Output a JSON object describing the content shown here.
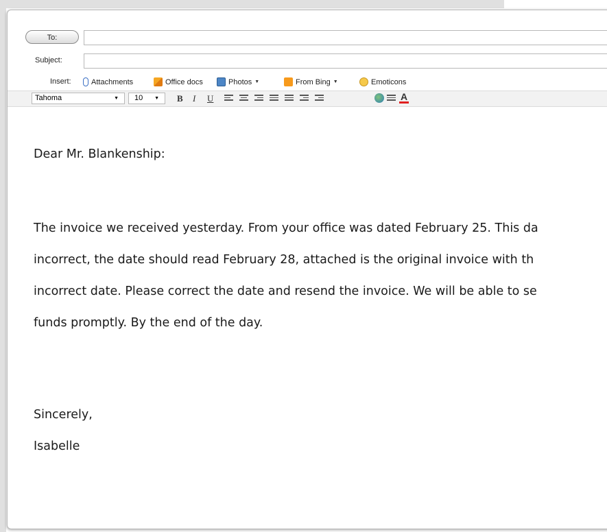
{
  "compose": {
    "to_button_label": "To:",
    "to_value": "",
    "subject_label": "Subject:",
    "subject_value": ""
  },
  "insert_bar": {
    "label": "Insert:",
    "items": [
      {
        "label": "Attachments",
        "icon": "paperclip-icon"
      },
      {
        "label": "Office docs",
        "icon": "office-docs-icon"
      },
      {
        "label": "Photos",
        "icon": "photos-icon",
        "dropdown": true
      },
      {
        "label": "From Bing",
        "icon": "bing-icon",
        "dropdown": true
      },
      {
        "label": "Emoticons",
        "icon": "emoticon-icon"
      }
    ]
  },
  "format_bar": {
    "font": "Tahoma",
    "size": "10",
    "bold": "B",
    "italic": "I",
    "underline": "U",
    "font_color_glyph": "A",
    "font_color": "#e02020"
  },
  "message": {
    "greeting": "Dear Mr. Blankenship:",
    "body_lines": [
      "The invoice we received yesterday. From your office was dated February 25.  This da",
      "incorrect, the date should read February 28, attached is the original invoice with th",
      "incorrect date. Please correct the date and resend the invoice. We will be able to se",
      "funds promptly. By the end of the day."
    ],
    "closing": "Sincerely,",
    "signature": "Isabelle"
  }
}
